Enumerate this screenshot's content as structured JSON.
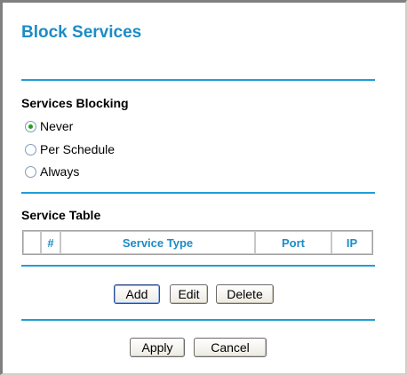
{
  "page": {
    "title": "Block Services"
  },
  "services_blocking": {
    "heading": "Services Blocking",
    "options": [
      {
        "label": "Never",
        "selected": true
      },
      {
        "label": "Per Schedule",
        "selected": false
      },
      {
        "label": "Always",
        "selected": false
      }
    ]
  },
  "service_table": {
    "heading": "Service Table",
    "columns": [
      "",
      "#",
      "Service Type",
      "Port",
      "IP"
    ]
  },
  "table_buttons": {
    "add": "Add",
    "edit": "Edit",
    "delete": "Delete"
  },
  "form_buttons": {
    "apply": "Apply",
    "cancel": "Cancel"
  },
  "colors": {
    "accent": "#1c8cc7",
    "rule": "#1f9dd6",
    "radio_dot": "#21a121"
  }
}
